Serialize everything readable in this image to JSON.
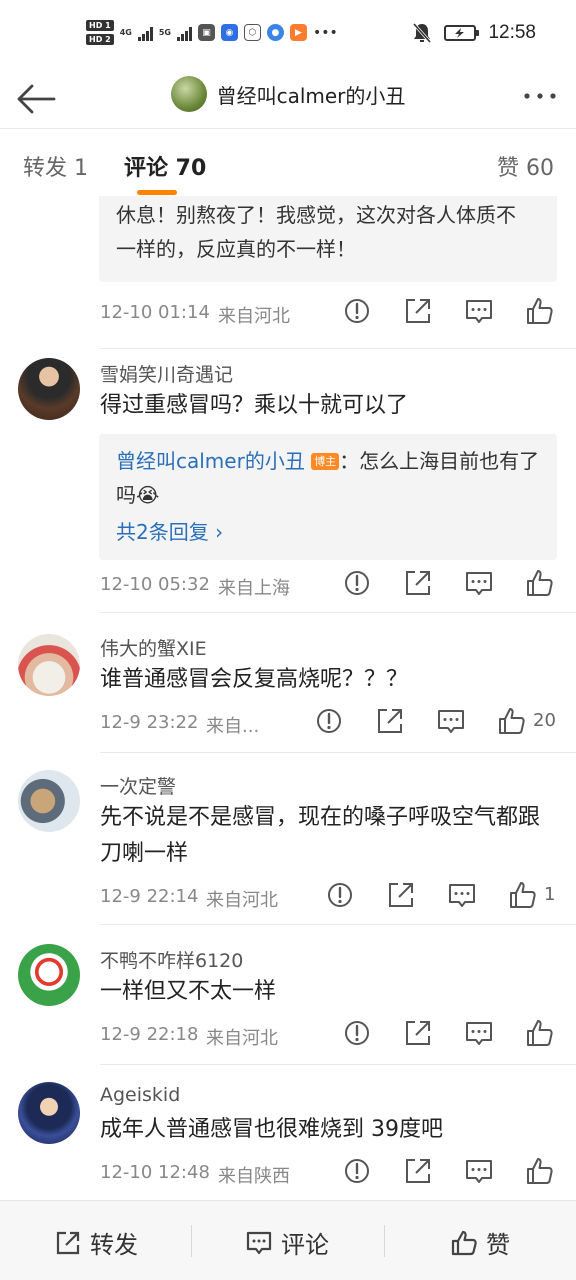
{
  "status": {
    "hd1": "HD 1",
    "hd2": "HD 2",
    "net1": "4G",
    "net2": "5G",
    "time": "12:58"
  },
  "header": {
    "title": "曾经叫calmer的小丑"
  },
  "tabs": {
    "repost": "转发 1",
    "comments": "评论 70",
    "likes": "赞 60"
  },
  "comments": [
    {
      "reply_text": "曾经叫calmer的小丑 博主：保重身体，早点休息！别熬夜了！我感觉，这次对各人体质不一样的，反应真的不一样！",
      "reply_line1": "休息！别熬夜了！我感觉，这次对各人体质不",
      "reply_line2": "一样的，反应真的不一样！",
      "time": "12-10 01:14",
      "location": "来自河北",
      "likes": ""
    },
    {
      "user": "雪娟笑川奇遇记",
      "text": "得过重感冒吗？乘以十就可以了",
      "reply_user": "曾经叫calmer的小丑",
      "reply_badge": "博主",
      "reply_body": "：怎么上海目前也有了吗😭",
      "reply_more": "共2条回复 ›",
      "time": "12-10 05:32",
      "location": "来自上海",
      "likes": ""
    },
    {
      "user": "伟大的蟹XIE",
      "text": "谁普通感冒会反复高烧呢？？？",
      "time": "12-9 23:22",
      "location": "来自...",
      "likes": "20"
    },
    {
      "user": "一次定警",
      "text": "先不说是不是感冒，现在的嗓子呼吸空气都跟刀喇一样",
      "time": "12-9 22:14",
      "location": "来自河北",
      "likes": "1"
    },
    {
      "user": "不鸭不咋样6120",
      "text": "一样但又不太一样",
      "time": "12-9 22:18",
      "location": "来自河北",
      "likes": ""
    },
    {
      "user": "Ageiskid",
      "text": "成年人普通感冒也很难烧到 39度吧",
      "time": "12-10 12:48",
      "location": "来自陕西",
      "likes": ""
    }
  ],
  "bottom": {
    "repost": "转发",
    "comment": "评论",
    "like": "赞"
  },
  "colors": {
    "accent": "#ff8200",
    "link": "#2a6fb8",
    "badge": "#ff8a23"
  }
}
